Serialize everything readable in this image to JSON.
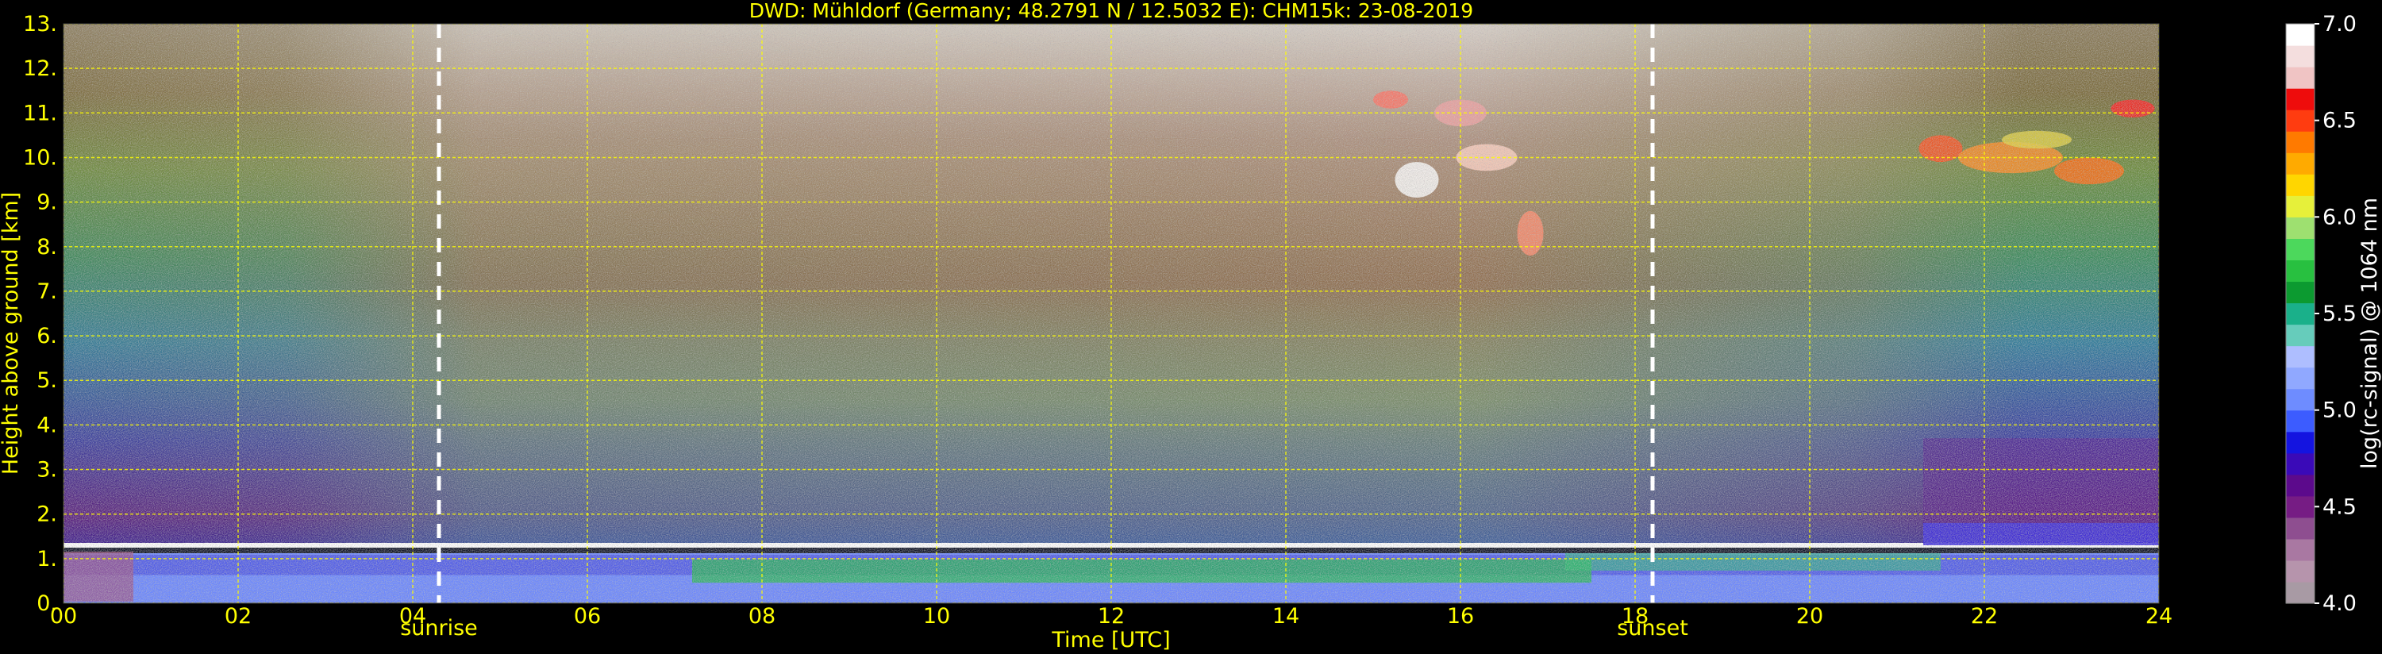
{
  "chart_data": {
    "type": "heatmap",
    "title": "DWD: Mühldorf (Germany; 48.2791 N / 12.5032 E):    CHM15k: 23-08-2019",
    "xlabel": "Time [UTC]",
    "ylabel": "Height above ground [km]",
    "xlim": [
      0,
      24
    ],
    "ylim": [
      0,
      13
    ],
    "xticks": [
      0,
      2,
      4,
      6,
      8,
      10,
      12,
      14,
      16,
      18,
      20,
      22,
      24
    ],
    "xticklabels": [
      "00",
      "02",
      "04",
      "06",
      "08",
      "10",
      "12",
      "14",
      "16",
      "18",
      "20",
      "22",
      "24"
    ],
    "yticks": [
      0,
      1,
      2,
      3,
      4,
      5,
      6,
      7,
      8,
      9,
      10,
      11,
      12,
      13
    ],
    "yticklabels": [
      "0.",
      "1.",
      "2.",
      "3.",
      "4.",
      "5.",
      "6.",
      "7.",
      "8.",
      "9.",
      "10.",
      "11.",
      "12.",
      "13."
    ],
    "grid": true,
    "events": [
      {
        "label": "sunrise",
        "time": 4.3
      },
      {
        "label": "sunset",
        "time": 18.2
      }
    ],
    "colorbar": {
      "label": "log(rc-signal) @ 1064 nm",
      "range": [
        4.0,
        7.0
      ],
      "ticks": [
        4.0,
        4.5,
        5.0,
        5.5,
        6.0,
        6.5,
        7.0
      ],
      "ticklabels": [
        "4.0",
        "4.5",
        "5.0",
        "5.5",
        "6.0",
        "6.5",
        "7.0"
      ],
      "colors": [
        "#a89aa4",
        "#b694ac",
        "#a978a2",
        "#8e4e90",
        "#761c84",
        "#5c0a8c",
        "#3a0ab8",
        "#1414e0",
        "#3c5cff",
        "#6e8cff",
        "#90a8ff",
        "#aebeff",
        "#66ccbb",
        "#1ab08a",
        "#0c9a30",
        "#28c040",
        "#4cd85c",
        "#9ee070",
        "#e6f03a",
        "#ffd600",
        "#ffaa00",
        "#ff7a00",
        "#ff3c10",
        "#ee0c0c",
        "#f0c4c4",
        "#f4dede",
        "#ffffff"
      ]
    },
    "features": {
      "boundary_layer_top_km": 1.3,
      "cirrus_layer_1": {
        "time_range": [
          15.0,
          17.0
        ],
        "height_km": [
          8.5,
          11.0
        ]
      },
      "cirrus_layer_2": {
        "time_range": [
          21.2,
          24.0
        ],
        "height_km": [
          9.5,
          11.2
        ]
      }
    },
    "colors": {
      "text": "#ffff00",
      "grid": "#ffff00",
      "event_line": "#ffffff",
      "colorbar_text": "#ffffff"
    }
  }
}
